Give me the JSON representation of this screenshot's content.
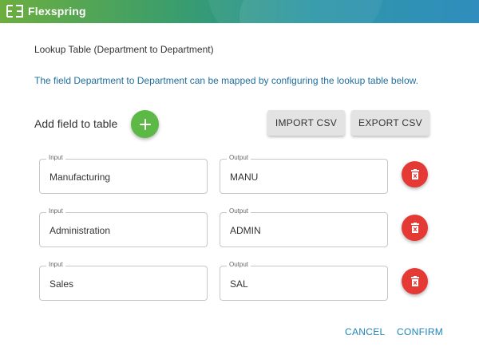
{
  "header": {
    "brand_name": "Flexspring",
    "logo_icon": "flexspring-logo-icon",
    "colors": {
      "gradient_start": "#6cae3f",
      "gradient_end": "#1f84b8"
    }
  },
  "dialog": {
    "title": "Lookup Table (Department to Department)",
    "description": "The field Department to Department can be mapped by configuring the lookup table below.",
    "add_field_label": "Add field to table",
    "add_button_icon": "plus-icon",
    "import_label": "IMPORT CSV",
    "export_label": "EXPORT CSV",
    "input_legend": "Input",
    "output_legend": "Output",
    "delete_icon": "trash-icon",
    "rows": [
      {
        "input": "Manufacturing",
        "output": "MANU"
      },
      {
        "input": "Administration",
        "output": "ADMIN"
      },
      {
        "input": "Sales",
        "output": "SAL"
      }
    ],
    "cancel_label": "CANCEL",
    "confirm_label": "CONFIRM"
  },
  "colors": {
    "accent_green": "#5cb946",
    "danger_red": "#e53935",
    "link_blue": "#1f84b8",
    "description_blue": "#1f6f9e"
  }
}
